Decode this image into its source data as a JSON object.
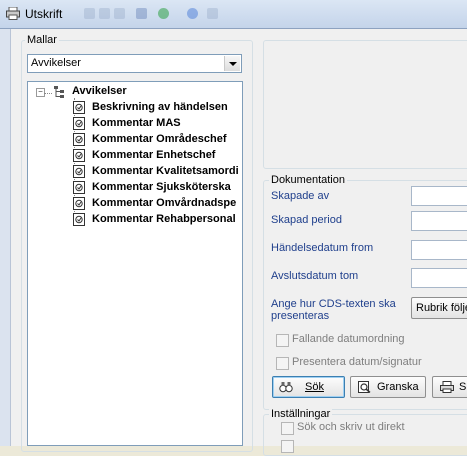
{
  "window": {
    "title": "Utskrift"
  },
  "mallar": {
    "group_label": "Mallar",
    "selected_template": "Avvikelser",
    "tree": {
      "root": "Avvikelser",
      "items": [
        "Beskrivning av händelsen",
        "Kommentar MAS",
        "Kommentar Områdeschef",
        "Kommentar Enhetschef",
        "Kommentar Kvalitetsamordi",
        "Kommentar Sjuksköterska",
        "Kommentar Omvårdnadspe",
        "Kommentar Rehabpersonal"
      ]
    }
  },
  "dokumentation": {
    "group_label": "Dokumentation",
    "fields": {
      "skapade_av": "Skapade av",
      "skapad_period": "Skapad period",
      "handelsedatum_from": "Händelsedatum from",
      "avslutsdatum_tom": "Avslutsdatum tom",
      "cds_label": "Ange hur CDS-texten ska presenteras"
    },
    "cds_button": "Rubrik följe",
    "checkboxes": {
      "fallande": "Fallande datumordning",
      "presentera": "Presentera datum/signatur"
    },
    "buttons": {
      "sok": "Sök",
      "granska": "Granska",
      "skriv": "S"
    }
  },
  "installningar": {
    "group_label": "Inställningar",
    "sok_och_skriv": "Sök och skriv ut direkt"
  }
}
